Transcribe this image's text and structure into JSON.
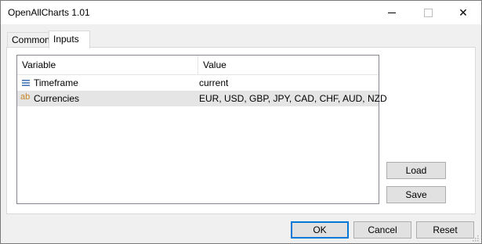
{
  "window": {
    "title": "OpenAllCharts 1.01",
    "close_glyph": "✕"
  },
  "tabs": [
    {
      "label": "Common"
    },
    {
      "label": "Inputs"
    }
  ],
  "grid": {
    "columns": [
      "Variable",
      "Value"
    ],
    "rows": [
      {
        "icon": "timeframe-icon",
        "name": "Timeframe",
        "value": "current"
      },
      {
        "icon": "ab",
        "name": "Currencies",
        "value": "EUR, USD, GBP, JPY, CAD, CHF, AUD, NZD"
      }
    ]
  },
  "side_buttons": {
    "load": "Load",
    "save": "Save"
  },
  "footer": {
    "ok": "OK",
    "cancel": "Cancel",
    "reset": "Reset"
  },
  "colors": {
    "accent": "#0078d7",
    "selected_row": "#e5e5e5"
  }
}
